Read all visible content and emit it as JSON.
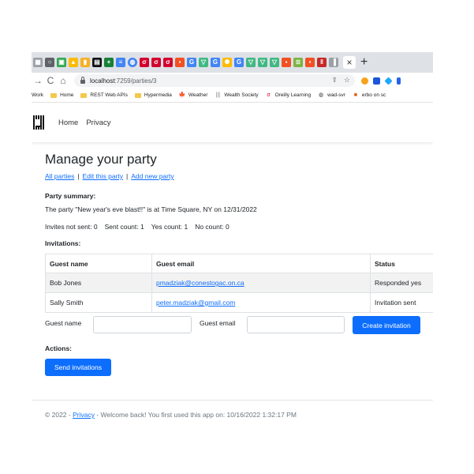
{
  "browser": {
    "tabs": {
      "favicons": [
        "tab-grid-icon",
        "circle-icon",
        "tab-image-icon",
        "drive-icon",
        "bookmark-icon",
        "stack-icon",
        "plus-square-icon",
        "document-icon",
        "globe-icon",
        "oreilly-icon",
        "oreilly-icon",
        "oreilly-icon",
        "microsoft-icon",
        "google-icon",
        "vue-icon",
        "google-icon",
        "sun-icon",
        "google-icon",
        "vue-icon",
        "vue-icon",
        "vue-icon",
        "microsoft-icon",
        "notes-icon",
        "microsoft-icon",
        "vertical-bars-icon",
        "sidebar-icon"
      ],
      "close_symbol": "×",
      "new_tab_symbol": "+"
    },
    "nav": {
      "back_symbol": "→",
      "reload_symbol": "C",
      "home_symbol": "⌂"
    },
    "url": {
      "host": "localhost",
      "path": ":7259/parties/3"
    },
    "omnibox_icons": [
      "share-icon",
      "star-icon"
    ],
    "bookmarks": [
      {
        "label": "Work",
        "icon": "none"
      },
      {
        "label": "Home",
        "icon": "folder-icon"
      },
      {
        "label": "REST Web APIs",
        "icon": "folder-icon"
      },
      {
        "label": "Hypermedia",
        "icon": "folder-icon"
      },
      {
        "label": "Weather",
        "icon": "maple-leaf-icon"
      },
      {
        "label": "Wealth Society",
        "icon": "bars-icon"
      },
      {
        "label": "Oreilly Learning",
        "icon": "oreilly-icon"
      },
      {
        "label": "wad-svr",
        "icon": "globe-icon"
      },
      {
        "label": "erbo on sc",
        "icon": "erbo-icon"
      }
    ]
  },
  "site": {
    "nav": {
      "home": "Home",
      "privacy": "Privacy"
    }
  },
  "page": {
    "title": "Manage your party",
    "links": {
      "all": "All parties",
      "edit": "Edit this party",
      "add": "Add new party",
      "separator": "|"
    },
    "summary_label": "Party summary:",
    "summary_text": "The party \"New year's eve blast!!\" is at Time Square, NY on 12/31/2022",
    "counts": {
      "not_sent": "Invites not sent: 0",
      "sent": "Sent count: 1",
      "yes": "Yes count: 1",
      "no": "No count: 0"
    },
    "invitations_label": "Invitations:",
    "table": {
      "headers": [
        "Guest name",
        "Guest email",
        "Status"
      ],
      "rows": [
        {
          "name": "Bob Jones",
          "email": "pmadziak@conestogac.on.ca",
          "status": "Responded yes"
        },
        {
          "name": "Sally Smith",
          "email": "peter.madziak@gmail.com",
          "status": "Invitation sent"
        }
      ]
    },
    "form": {
      "guest_name_label": "Guest name",
      "guest_name_value": "",
      "guest_email_label": "Guest email",
      "guest_email_value": "",
      "create_button": "Create invitation"
    },
    "actions_label": "Actions:",
    "send_button": "Send invitations"
  },
  "footer": {
    "prefix": "© 2022 - ",
    "privacy_link": "Privacy",
    "suffix": " - Welcome back! You first used this app on: 10/16/2022 1:32:17 PM"
  }
}
